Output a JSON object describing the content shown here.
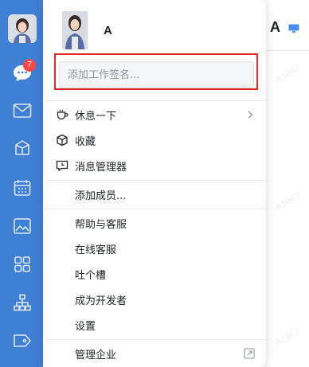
{
  "background": {
    "title": "A",
    "watermarks": [
      "A1067",
      "A1067",
      "A1067"
    ]
  },
  "rail": {
    "items": [
      {
        "icon": "avatar"
      },
      {
        "icon": "chat-bubble-icon",
        "badge": "7"
      },
      {
        "icon": "mail-icon"
      },
      {
        "icon": "box-icon"
      },
      {
        "icon": "calendar-icon"
      },
      {
        "icon": "image-icon"
      },
      {
        "icon": "apps-grid-icon"
      },
      {
        "icon": "org-chart-icon"
      },
      {
        "icon": "tag-icon"
      }
    ]
  },
  "panel": {
    "user_name": "A",
    "signature_placeholder": "添加工作签名...",
    "menu": {
      "rest": "休息一下",
      "favorites": "收藏",
      "message_manager": "消息管理器",
      "add_member": "添加成员...",
      "help": "帮助与客服",
      "online_service": "在线客服",
      "feedback": "吐个槽",
      "developer": "成为开发者",
      "settings": "设置",
      "manage_enterprise": "管理企业"
    }
  },
  "colors": {
    "rail": "#3f7fd4",
    "badge": "#f54a45",
    "highlight_outline": "#e02828"
  }
}
